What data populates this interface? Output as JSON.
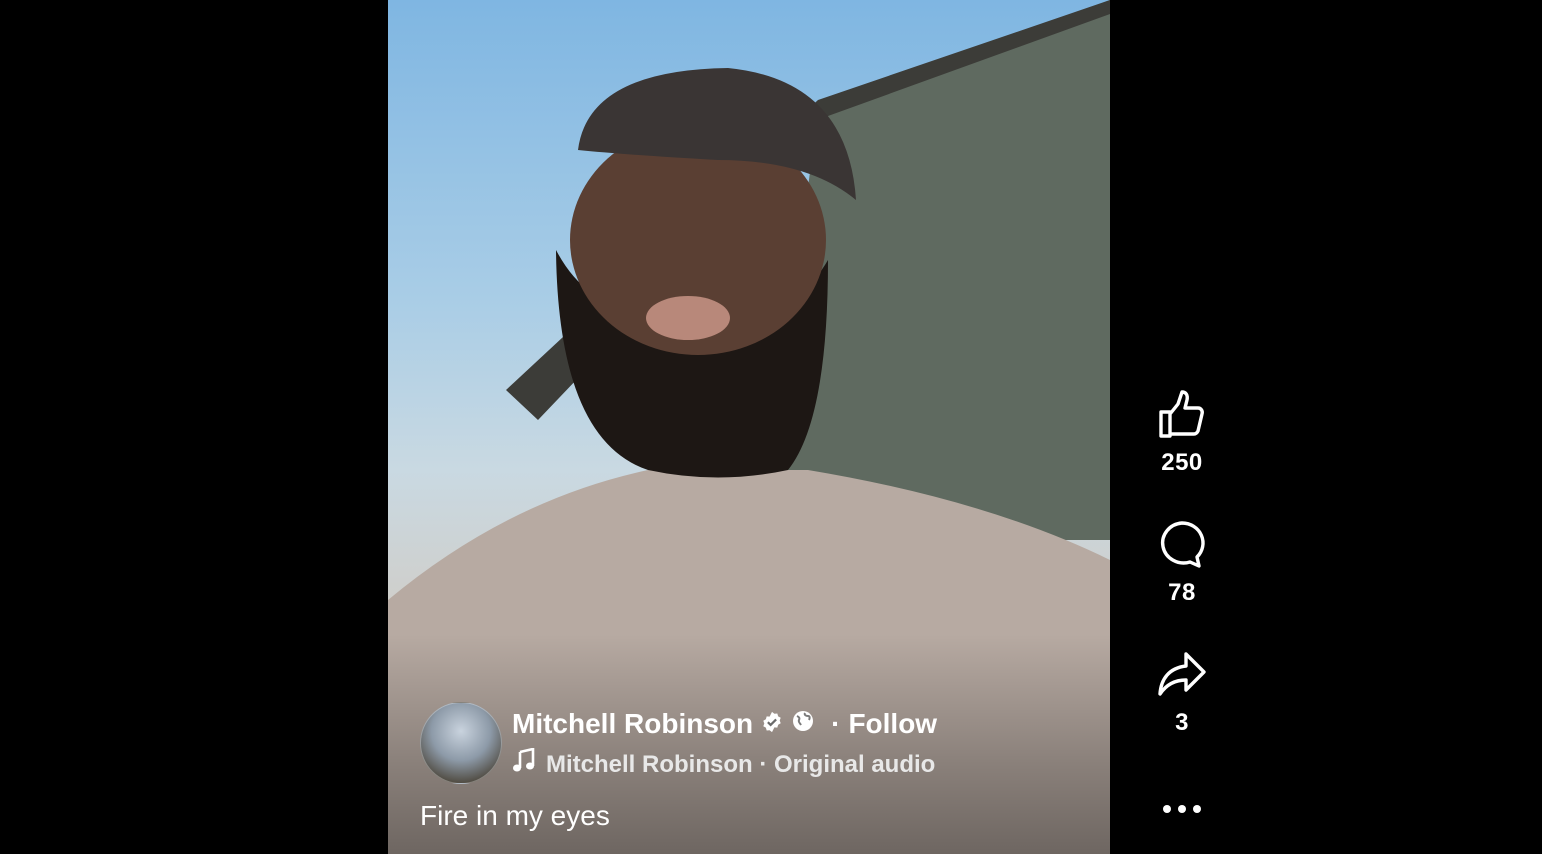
{
  "post": {
    "author_name": "Mitchell Robinson",
    "follow_label": "Follow",
    "follow_separator": "·",
    "audio_label": "Mitchell Robinson · Original audio",
    "caption": "Fire in my eyes"
  },
  "actions": {
    "like_count": "250",
    "comment_count": "78",
    "share_count": "3"
  },
  "icons": {
    "verified": "verified-badge-icon",
    "audience": "globe-icon",
    "audio": "music-note-icon",
    "like": "thumbs-up-icon",
    "comment": "comment-bubble-icon",
    "share": "share-arrow-icon",
    "more": "more-dots-icon"
  }
}
